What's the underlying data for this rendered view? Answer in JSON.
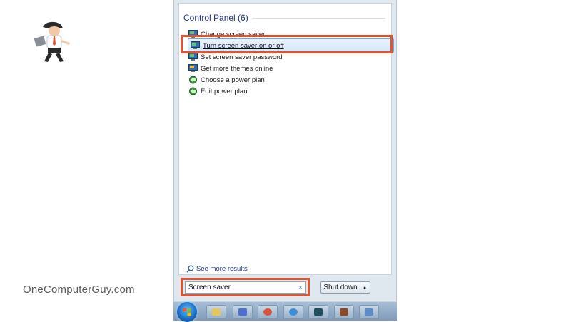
{
  "brand": {
    "name": "OneComputerGuy.com"
  },
  "start_menu": {
    "group": {
      "title": "Control Panel (6)"
    },
    "results": [
      {
        "label": "Change screen saver",
        "icon": "display-icon",
        "selected": false
      },
      {
        "label": "Turn screen saver on or off",
        "icon": "display-icon",
        "selected": true
      },
      {
        "label": "Set screen saver password",
        "icon": "display-icon",
        "selected": false
      },
      {
        "label": "Get more themes online",
        "icon": "display-icon",
        "selected": false
      },
      {
        "label": "Choose a power plan",
        "icon": "power-plan-icon",
        "selected": false
      },
      {
        "label": "Edit power plan",
        "icon": "power-plan-icon",
        "selected": false
      }
    ],
    "see_more": {
      "label": "See more results",
      "icon": "search-icon"
    },
    "search": {
      "value": "Screen saver",
      "clear_glyph": "×"
    },
    "shutdown": {
      "label": "Shut down",
      "arrow_glyph": "▸"
    }
  },
  "taskbar": {
    "start_icon": "windows-orb-icon",
    "pinned": [
      {
        "icon": "explorer-icon",
        "color": "#e6c75a"
      },
      {
        "icon": "calendar-icon",
        "color": "#4c6fd0"
      },
      {
        "icon": "chrome-icon",
        "color": "#d9533c"
      },
      {
        "icon": "ie-icon",
        "color": "#3a8fd8"
      },
      {
        "icon": "terminal-icon",
        "color": "#1f4f5c"
      },
      {
        "icon": "app-icon",
        "color": "#8a4a2a"
      },
      {
        "icon": "remote-desktop-icon",
        "color": "#5a8ec8"
      }
    ]
  },
  "colors": {
    "highlight": "#e0532f",
    "link": "#1e3287"
  }
}
